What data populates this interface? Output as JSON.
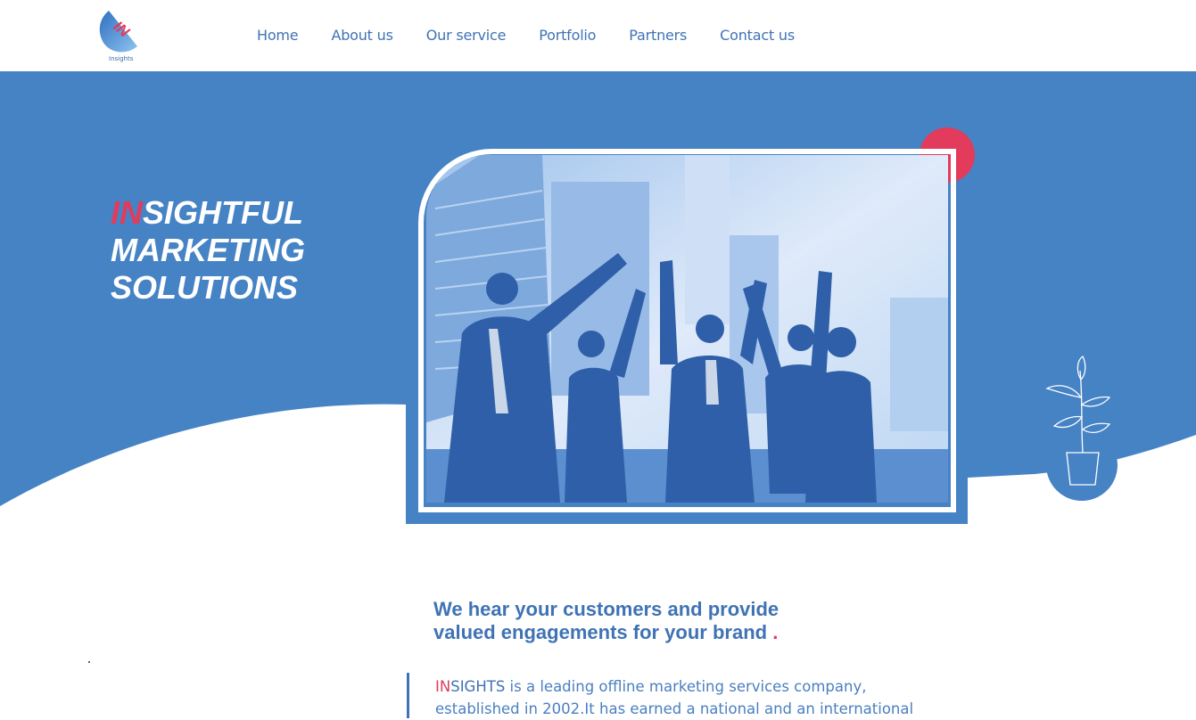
{
  "header": {
    "logo_text": "Insights",
    "nav": [
      {
        "label": "Home"
      },
      {
        "label": "About us"
      },
      {
        "label": "Our service"
      },
      {
        "label": "Portfolio"
      },
      {
        "label": "Partners"
      },
      {
        "label": "Contact us"
      }
    ]
  },
  "hero": {
    "title_accent": "IN",
    "title_rest_1": "SIGHTFUL",
    "title_line_2": "MARKETING",
    "title_line_3": "SOLUTIONS",
    "image_description": "photo-team-celebrating"
  },
  "intro": {
    "tagline_line_1": "We hear your customers and provide",
    "tagline_line_2": "valued engagements for your brand",
    "tagline_dot": ".",
    "brand_accent": "IN",
    "brand_rest": "SIGHTS",
    "description": " is a leading offline marketing services company, established in 2002.It has earned a national and an international"
  },
  "colors": {
    "primary_blue": "#4683c5",
    "accent_red": "#e23b5c",
    "text_blue": "#3f73b4"
  }
}
